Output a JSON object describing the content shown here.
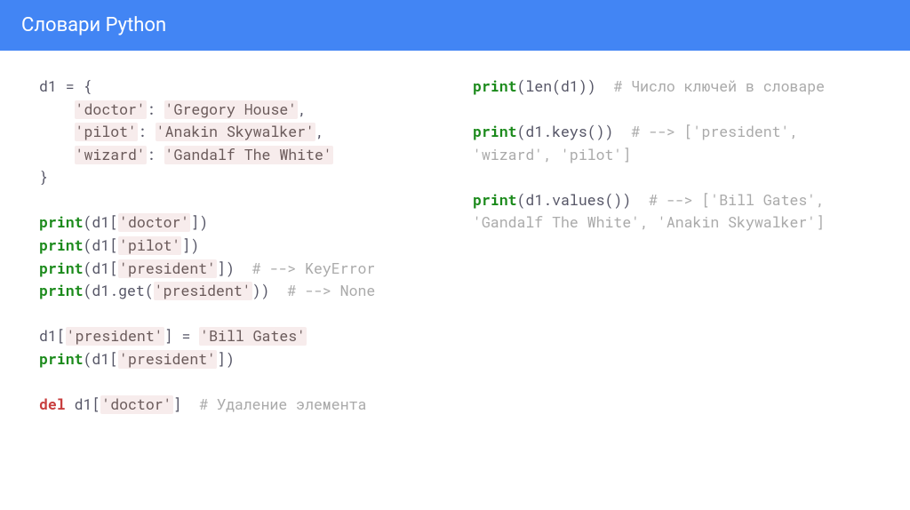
{
  "header": {
    "title": "Словари Python"
  },
  "code": {
    "left": {
      "l1": "d1 = {",
      "l2a": "    ",
      "l2s": "'doctor'",
      "l2b": ": ",
      "l2s2": "'Gregory House'",
      "l2c": ",",
      "l3a": "    ",
      "l3s": "'pilot'",
      "l3b": ": ",
      "l3s2": "'Anakin Skywalker'",
      "l3c": ",",
      "l4a": "    ",
      "l4s": "'wizard'",
      "l4b": ": ",
      "l4s2": "'Gandalf The White'",
      "l5": "}",
      "p1a": "print",
      "p1b": "(d1[",
      "p1s": "'doctor'",
      "p1c": "])",
      "p2a": "print",
      "p2b": "(d1[",
      "p2s": "'pilot'",
      "p2c": "])",
      "p3a": "print",
      "p3b": "(d1[",
      "p3s": "'president'",
      "p3c": "])  ",
      "p3cm": "# --> KeyError",
      "p4a": "print",
      "p4b": "(d1.get(",
      "p4s": "'president'",
      "p4c": "))  ",
      "p4cm": "# --> None",
      "asg1": "d1[",
      "asg1s": "'president'",
      "asg1b": "] = ",
      "asg1s2": "'Bill Gates'",
      "p5a": "print",
      "p5b": "(d1[",
      "p5s": "'president'",
      "p5c": "])",
      "del1": "del",
      "del1b": " d1[",
      "del1s": "'doctor'",
      "del1c": "]  ",
      "del1cm": "# Удаление элемента"
    },
    "right": {
      "r1a": "print",
      "r1b": "(len(d1))  ",
      "r1cm": "# Число ключей в словаре",
      "r2a": "print",
      "r2b": "(d1.keys())  ",
      "r2cm": "# --> ['president', 'wizard', 'pilot']",
      "r3a": "print",
      "r3b": "(d1.values())  ",
      "r3cm": "# --> ['Bill Gates', 'Gandalf The White', 'Anakin Skywalker']"
    }
  }
}
